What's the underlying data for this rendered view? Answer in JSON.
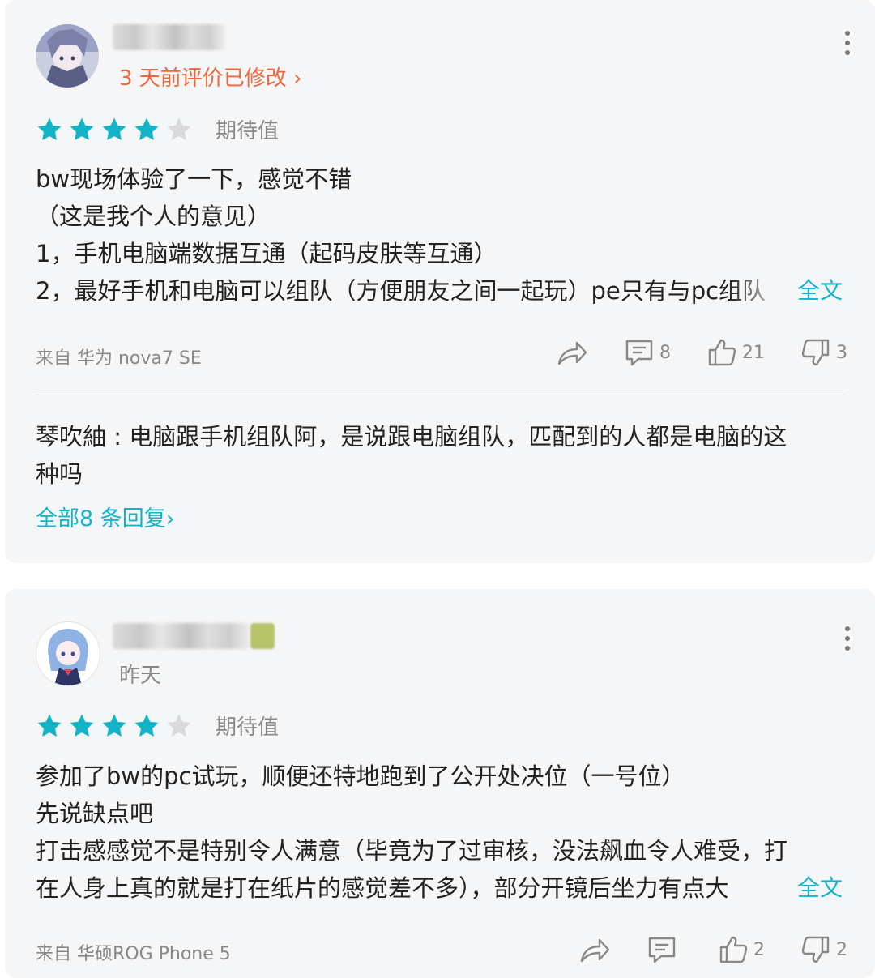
{
  "reviews": [
    {
      "user_name": "",
      "time_text": "3 天前评价已修改",
      "time_chevron": "›",
      "rating": 4,
      "rating_max": 5,
      "rating_label": "期待值",
      "lines": [
        "bw现场体验了一下，感觉不错",
        "（这是我个人的意见）",
        "1，手机电脑端数据互通（起码皮肤等互通）",
        "2，最好手机和电脑可以组队（方便朋友之间一起玩）pe只有与pc组队"
      ],
      "full_text_label": "全文",
      "device": "来自 华为 nova7 SE",
      "replies_count": "8",
      "likes": "21",
      "dislikes": "3",
      "reply_preview": "琴吹紬 : 电脑跟手机组队阿，是说跟电脑组队，匹配到的人都是电脑的这种吗",
      "reply_preview_lines": [
        "琴吹紬 : 电脑跟手机组队阿，是说跟电脑组队，匹配到的人都是电脑的这",
        "种吗"
      ],
      "all_replies_label": "全部8 条回复›"
    },
    {
      "user_name": "",
      "time_text": "昨天",
      "rating": 4,
      "rating_max": 5,
      "rating_label": "期待值",
      "lines": [
        "参加了bw的pc试玩，顺便还特地跑到了公开处决位（一号位）",
        "先说缺点吧",
        "打击感感觉不是特别令人满意（毕竟为了过审核，没法飙血令人难受，打",
        "在人身上真的就是打在纸片的感觉差不多），部分开镜后坐力有点大"
      ],
      "full_text_label": "全文",
      "device": "来自 华硕ROG Phone 5",
      "replies_count": "",
      "likes": "2",
      "dislikes": "2"
    }
  ],
  "colors": {
    "accent": "#14b4c8",
    "star_filled": "#14b4c8",
    "star_empty": "#d8dadd",
    "time_orange": "#f0683a",
    "card_bg": "#f5f6f8"
  },
  "icons": [
    "more-vertical-icon",
    "star-icon",
    "share-icon",
    "comment-icon",
    "thumbs-up-icon",
    "thumbs-down-icon"
  ]
}
